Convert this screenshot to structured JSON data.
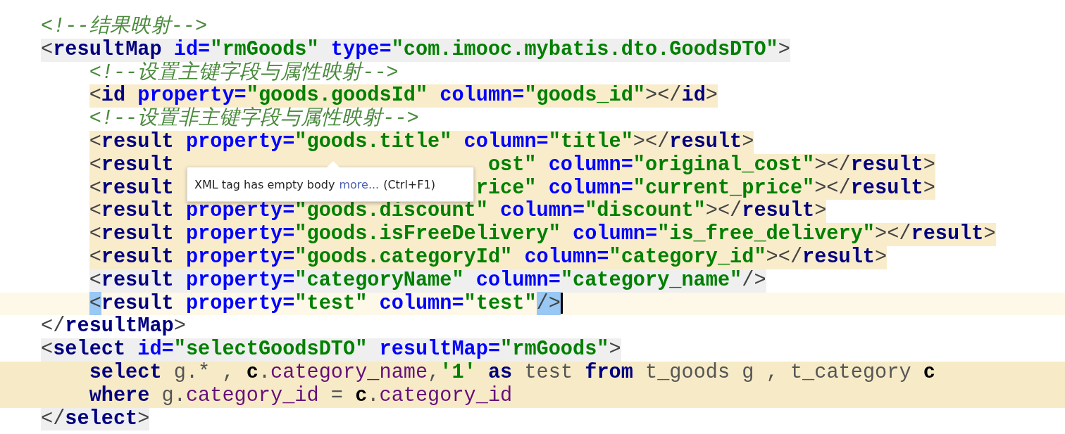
{
  "editor": {
    "lines": [
      {
        "kind": "none",
        "tokens": [
          {
            "kind": "comment",
            "text": "<!--结果映射-->"
          }
        ]
      },
      {
        "kind": "context",
        "tokens": [
          {
            "kind": "punct",
            "text": "<"
          },
          {
            "kind": "tag",
            "text": "resultMap"
          },
          {
            "kind": "attr",
            "text": " id="
          },
          {
            "kind": "value",
            "text": "\"rmGoods\""
          },
          {
            "kind": "attr",
            "text": " type="
          },
          {
            "kind": "value",
            "text": "\"com.imooc.mybatis.dto.GoodsDTO\""
          },
          {
            "kind": "punct",
            "text": ">"
          }
        ],
        "children": [
          {
            "kind": "none",
            "tokens": [
              {
                "kind": "comment",
                "text": "<!--设置主键字段与属性映射-->"
              }
            ]
          },
          {
            "kind": "warning",
            "tokens": [
              {
                "kind": "punct",
                "text": "<"
              },
              {
                "kind": "tag",
                "text": "id"
              },
              {
                "kind": "attr",
                "text": " property="
              },
              {
                "kind": "value",
                "text": "\"goods.goodsId\""
              },
              {
                "kind": "attr",
                "text": " column="
              },
              {
                "kind": "value",
                "text": "\"goods_id\""
              },
              {
                "kind": "punct",
                "text": "></"
              },
              {
                "kind": "tag",
                "text": "id"
              },
              {
                "kind": "punct",
                "text": ">"
              }
            ]
          },
          {
            "kind": "none",
            "tokens": [
              {
                "kind": "comment",
                "text": "<!--设置非主键字段与属性映射-->"
              }
            ]
          },
          {
            "kind": "warning",
            "tokens": [
              {
                "kind": "punct",
                "text": "<"
              },
              {
                "kind": "tag",
                "text": "result"
              },
              {
                "kind": "attr",
                "text": " property="
              },
              {
                "kind": "value",
                "text": "\"goods.title\""
              },
              {
                "kind": "attr",
                "text": " column="
              },
              {
                "kind": "value",
                "text": "\"title\""
              },
              {
                "kind": "punct",
                "text": "></"
              },
              {
                "kind": "tag",
                "text": "result"
              },
              {
                "kind": "punct",
                "text": ">"
              }
            ]
          },
          {
            "kind": "warning",
            "tokens": [
              {
                "kind": "punct",
                "text": "<"
              },
              {
                "kind": "tag",
                "text": "result"
              }
            ],
            "tail": [
              {
                "kind": "value",
                "text": "ost\""
              },
              {
                "kind": "attr",
                "text": " column="
              },
              {
                "kind": "value",
                "text": "\"original_cost\""
              },
              {
                "kind": "punct",
                "text": "></"
              },
              {
                "kind": "tag",
                "text": "result"
              },
              {
                "kind": "punct",
                "text": ">"
              }
            ]
          },
          {
            "kind": "warning",
            "tokens": [
              {
                "kind": "punct",
                "text": "<"
              },
              {
                "kind": "tag",
                "text": "result"
              }
            ],
            "tail": [
              {
                "kind": "value",
                "text": "rice\""
              },
              {
                "kind": "attr",
                "text": " column="
              },
              {
                "kind": "value",
                "text": "\"current_price\""
              },
              {
                "kind": "punct",
                "text": "></"
              },
              {
                "kind": "tag",
                "text": "result"
              },
              {
                "kind": "punct",
                "text": ">"
              }
            ]
          },
          {
            "kind": "warning",
            "tokens": [
              {
                "kind": "punct",
                "text": "<"
              },
              {
                "kind": "tag",
                "text": "result"
              },
              {
                "kind": "attr",
                "text": " property="
              },
              {
                "kind": "value",
                "text": "\"goods.discount\""
              },
              {
                "kind": "attr",
                "text": " column="
              },
              {
                "kind": "value",
                "text": "\"discount\""
              },
              {
                "kind": "punct",
                "text": "></"
              },
              {
                "kind": "tag",
                "text": "result"
              },
              {
                "kind": "punct",
                "text": ">"
              }
            ]
          },
          {
            "kind": "warning",
            "tokens": [
              {
                "kind": "punct",
                "text": "<"
              },
              {
                "kind": "tag",
                "text": "result"
              },
              {
                "kind": "attr",
                "text": " property="
              },
              {
                "kind": "value",
                "text": "\"goods.isFreeDelivery\""
              },
              {
                "kind": "attr",
                "text": " column="
              },
              {
                "kind": "value",
                "text": "\"is_free_delivery\""
              },
              {
                "kind": "punct",
                "text": "></"
              },
              {
                "kind": "tag",
                "text": "result"
              },
              {
                "kind": "punct",
                "text": ">"
              }
            ]
          },
          {
            "kind": "warning",
            "tokens": [
              {
                "kind": "punct",
                "text": "<"
              },
              {
                "kind": "tag",
                "text": "result"
              },
              {
                "kind": "attr",
                "text": " property="
              },
              {
                "kind": "value",
                "text": "\"goods.categoryId\""
              },
              {
                "kind": "attr",
                "text": " column="
              },
              {
                "kind": "value",
                "text": "\"category_id\""
              },
              {
                "kind": "punct",
                "text": "></"
              },
              {
                "kind": "tag",
                "text": "result"
              },
              {
                "kind": "punct",
                "text": ">"
              }
            ]
          },
          {
            "kind": "context",
            "tokens": [
              {
                "kind": "punct",
                "text": "<"
              },
              {
                "kind": "tag",
                "text": "result"
              },
              {
                "kind": "attr",
                "text": " property="
              },
              {
                "kind": "value",
                "text": "\"categoryName\""
              },
              {
                "kind": "attr",
                "text": " column="
              },
              {
                "kind": "value",
                "text": "\"category_name\""
              },
              {
                "kind": "punct",
                "text": "/>"
              }
            ]
          },
          {
            "kind": "current",
            "tokens": [
              {
                "kind": "matched",
                "text": "<"
              },
              {
                "kind": "tag",
                "text": "result"
              },
              {
                "kind": "attr",
                "text": " property="
              },
              {
                "kind": "value",
                "text": "\"test\""
              },
              {
                "kind": "attr",
                "text": " column="
              },
              {
                "kind": "value",
                "text": "\"test\""
              },
              {
                "kind": "matched",
                "text": "/>"
              }
            ]
          }
        ]
      },
      {
        "kind": "none",
        "tokens": [
          {
            "kind": "punct",
            "text": "</"
          },
          {
            "kind": "tag",
            "text": "resultMap"
          },
          {
            "kind": "punct",
            "text": ">"
          }
        ]
      },
      {
        "kind": "context",
        "tokens": [
          {
            "kind": "punct",
            "text": "<"
          },
          {
            "kind": "tag",
            "text": "select"
          },
          {
            "kind": "attr",
            "text": " id="
          },
          {
            "kind": "value",
            "text": "\"selectGoodsDTO\""
          },
          {
            "kind": "attr",
            "text": " resultMap="
          },
          {
            "kind": "value",
            "text": "\"rmGoods\""
          },
          {
            "kind": "punct",
            "text": ">"
          }
        ],
        "children": [
          {
            "kind": "sql",
            "tokens": [
              {
                "kind": "keyword",
                "text": "select"
              },
              {
                "kind": "plain",
                "text": " g.* , "
              },
              {
                "kind": "alias",
                "text": "c"
              },
              {
                "kind": "plain",
                "text": "."
              },
              {
                "kind": "column",
                "text": "category_name"
              },
              {
                "kind": "plain",
                "text": ","
              },
              {
                "kind": "string",
                "text": "'1'"
              },
              {
                "kind": "keyword",
                "text": " as"
              },
              {
                "kind": "plain",
                "text": " test "
              },
              {
                "kind": "keyword",
                "text": "from"
              },
              {
                "kind": "plain",
                "text": " t_goods g , t_category "
              },
              {
                "kind": "alias",
                "text": "c"
              }
            ]
          },
          {
            "kind": "sql",
            "tokens": [
              {
                "kind": "keyword",
                "text": "where"
              },
              {
                "kind": "plain",
                "text": " g."
              },
              {
                "kind": "column",
                "text": "category_id"
              },
              {
                "kind": "plain",
                "text": " = "
              },
              {
                "kind": "alias",
                "text": "c"
              },
              {
                "kind": "plain",
                "text": "."
              },
              {
                "kind": "column",
                "text": "category_id"
              }
            ]
          }
        ]
      },
      {
        "kind": "context",
        "tokens": [
          {
            "kind": "punct",
            "text": "</"
          },
          {
            "kind": "tag",
            "text": "select"
          },
          {
            "kind": "punct",
            "text": ">"
          }
        ]
      }
    ]
  },
  "tooltip": {
    "message": "XML tag has empty body",
    "link": "more...",
    "shortcut": "(Ctrl+F1)"
  }
}
